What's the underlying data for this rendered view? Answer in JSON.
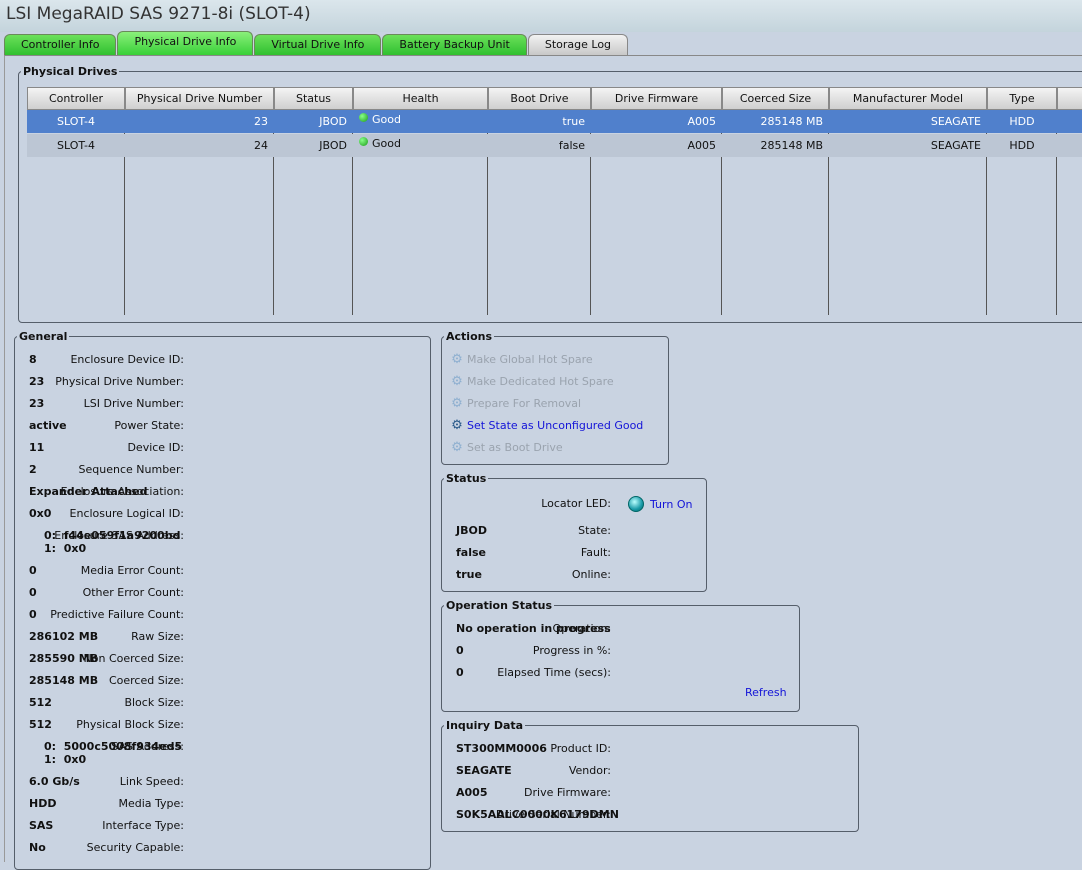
{
  "title": "LSI MegaRAID SAS 9271-8i (SLOT-4)",
  "tabs": [
    "Controller Info",
    "Physical Drive Info",
    "Virtual Drive Info",
    "Battery Backup Unit",
    "Storage Log"
  ],
  "physical_drives": {
    "legend": "Physical Drives",
    "columns": [
      "Controller",
      "Physical Drive Number",
      "Status",
      "Health",
      "Boot Drive",
      "Drive Firmware",
      "Coerced Size",
      "Manufacturer Model",
      "Type"
    ],
    "rows": [
      [
        "SLOT-4",
        "23",
        "JBOD",
        "Good",
        "true",
        "A005",
        "285148 MB",
        "SEAGATE",
        "HDD"
      ],
      [
        "SLOT-4",
        "24",
        "JBOD",
        "Good",
        "false",
        "A005",
        "285148 MB",
        "SEAGATE",
        "HDD"
      ]
    ]
  },
  "general": {
    "legend": "General",
    "items": [
      [
        "Enclosure Device ID:",
        "8"
      ],
      [
        "Physical Drive Number:",
        "23"
      ],
      [
        "LSI Drive Number:",
        "23"
      ],
      [
        "Power State:",
        "active"
      ],
      [
        "Device ID:",
        "11"
      ],
      [
        "Sequence Number:",
        "2"
      ],
      [
        "Enclosure Association:",
        "Expander Attached"
      ],
      [
        "Enclosure Logical ID:",
        "0x0"
      ],
      [
        "Enclosure SAS Address:",
        "0:  f44e059f1a9200bd",
        "1:  0x0"
      ],
      [
        "Media Error Count:",
        "0"
      ],
      [
        "Other Error Count:",
        "0"
      ],
      [
        "Predictive Failure Count:",
        "0"
      ],
      [
        "Raw Size:",
        "286102 MB"
      ],
      [
        "Non Coerced Size:",
        "285590 MB"
      ],
      [
        "Coerced Size:",
        "285148 MB"
      ],
      [
        "Block Size:",
        "512"
      ],
      [
        "Physical Block Size:",
        "512"
      ],
      [
        "SAS Address:",
        "0:  5000c5008f934ed5",
        "1:  0x0"
      ],
      [
        "Link Speed:",
        "6.0 Gb/s"
      ],
      [
        "Media Type:",
        "HDD"
      ],
      [
        "Interface Type:",
        "SAS"
      ],
      [
        "Security Capable:",
        "No"
      ]
    ]
  },
  "actions": {
    "legend": "Actions",
    "items": [
      "Make Global Hot Spare",
      "Make Dedicated Hot Spare",
      "Prepare For Removal",
      "Set State as Unconfigured Good",
      "Set as Boot Drive"
    ]
  },
  "status": {
    "legend": "Status",
    "locator_label": "Locator LED:",
    "locator_action": "Turn On",
    "items": [
      [
        "State:",
        "JBOD"
      ],
      [
        "Fault:",
        "false"
      ],
      [
        "Online:",
        "true"
      ]
    ]
  },
  "operation": {
    "legend": "Operation Status",
    "items": [
      [
        "Operation:",
        "No operation in progress"
      ],
      [
        "Progress in %:",
        "0"
      ],
      [
        "Elapsed Time (secs):",
        "0"
      ]
    ],
    "refresh": "Refresh"
  },
  "inquiry": {
    "legend": "Inquiry Data",
    "items": [
      [
        "Product ID:",
        "ST300MM0006"
      ],
      [
        "Vendor:",
        "SEAGATE"
      ],
      [
        "Drive Firmware:",
        "A005"
      ],
      [
        "Drive Serial Number:",
        "S0K5AALC0000K6179DMN"
      ]
    ]
  },
  "colors": {
    "selected_row": "#5080cc",
    "tab_green": "#38d038",
    "link": "#1414d8"
  }
}
